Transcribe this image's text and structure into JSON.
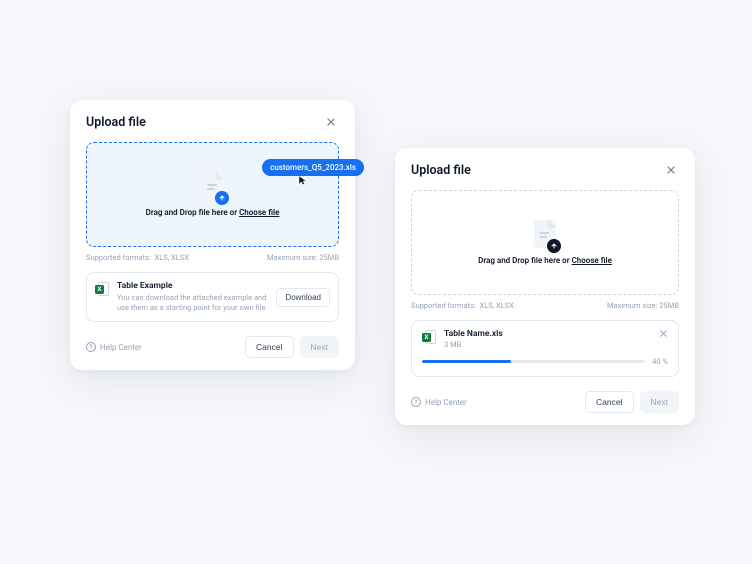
{
  "leftCard": {
    "title": "Upload file",
    "draggedFileName": "customers_Q5_2023.xls",
    "dropText": "Drag and Drop file here or ",
    "chooseText": "Choose file",
    "supportedLabel": "Supported formats:",
    "supportedValue": "XLS, XLSX",
    "maxSizeLabel": "Maximum size:",
    "maxSizeValue": "25MB",
    "example": {
      "title": "Table Example",
      "desc": "You can download the attached example and use them as a starting point for your own file.",
      "downloadLabel": "Download"
    },
    "helpLabel": "Help Center",
    "cancelLabel": "Cancel",
    "nextLabel": "Next"
  },
  "rightCard": {
    "title": "Upload file",
    "dropText": "Drag and Drop file here or ",
    "chooseText": "Choose file",
    "supportedLabel": "Supported formats:",
    "supportedValue": "XLS, XLSX",
    "maxSizeLabel": "Maximum size:",
    "maxSizeValue": "25MB",
    "upload": {
      "name": "Table Name.xls",
      "size": "3 MB",
      "percent": 40,
      "percentLabel": "40 %"
    },
    "helpLabel": "Help Center",
    "cancelLabel": "Cancel",
    "nextLabel": "Next"
  }
}
